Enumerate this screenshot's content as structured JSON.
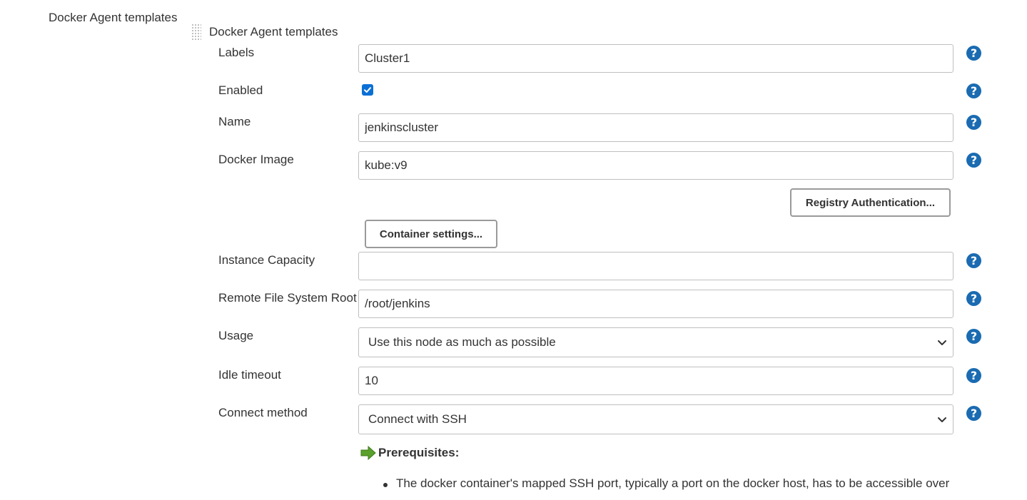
{
  "section_title": "Docker Agent templates",
  "subsection_title": "Docker Agent templates",
  "labels": {
    "labels": "Labels",
    "enabled": "Enabled",
    "name": "Name",
    "docker_image": "Docker Image",
    "instance_capacity": "Instance Capacity",
    "remote_fs_root": "Remote File System Root",
    "usage": "Usage",
    "idle_timeout": "Idle timeout",
    "connect_method": "Connect method"
  },
  "values": {
    "labels": "Cluster1",
    "enabled": true,
    "name": "jenkinscluster",
    "docker_image": "kube:v9",
    "instance_capacity": "",
    "remote_fs_root": "/root/jenkins",
    "usage": "Use this node as much as possible",
    "idle_timeout": "10",
    "connect_method": "Connect with SSH"
  },
  "buttons": {
    "registry_auth": "Registry Authentication...",
    "container_settings": "Container settings..."
  },
  "help_icon_glyph": "?",
  "prerequisites": {
    "title": "Prerequisites:",
    "icon": "green-arrow-icon",
    "items": [
      "The docker container's mapped SSH port, typically a port on the docker host, has to be accessible over"
    ]
  },
  "colors": {
    "help_icon": "#1a6bb1",
    "checkbox": "#0b6fd6",
    "arrow": "#5aa02c"
  }
}
